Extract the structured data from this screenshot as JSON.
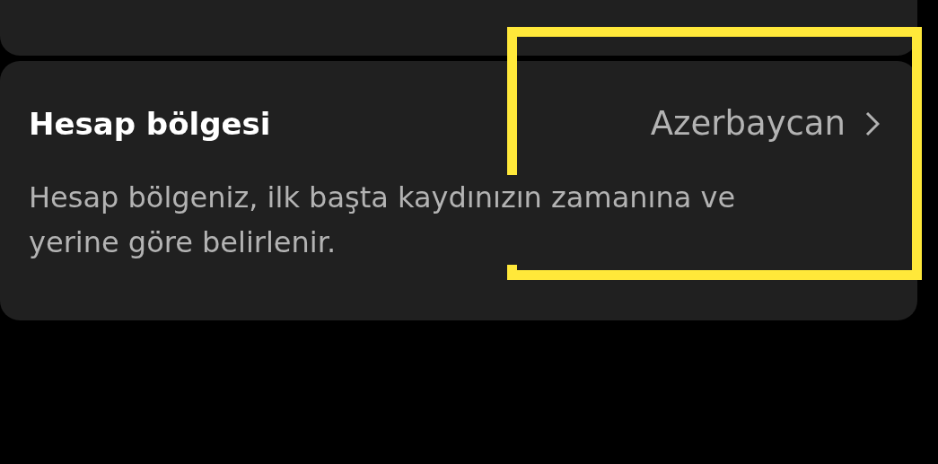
{
  "setting": {
    "title": "Hesap bölgesi",
    "value": "Azerbaycan",
    "description": "Hesap bölgeniz, ilk başta kaydınızın zamanına ve yerine göre belirlenir."
  },
  "highlight": {
    "kind": "frame",
    "color": "#ffe83a"
  }
}
